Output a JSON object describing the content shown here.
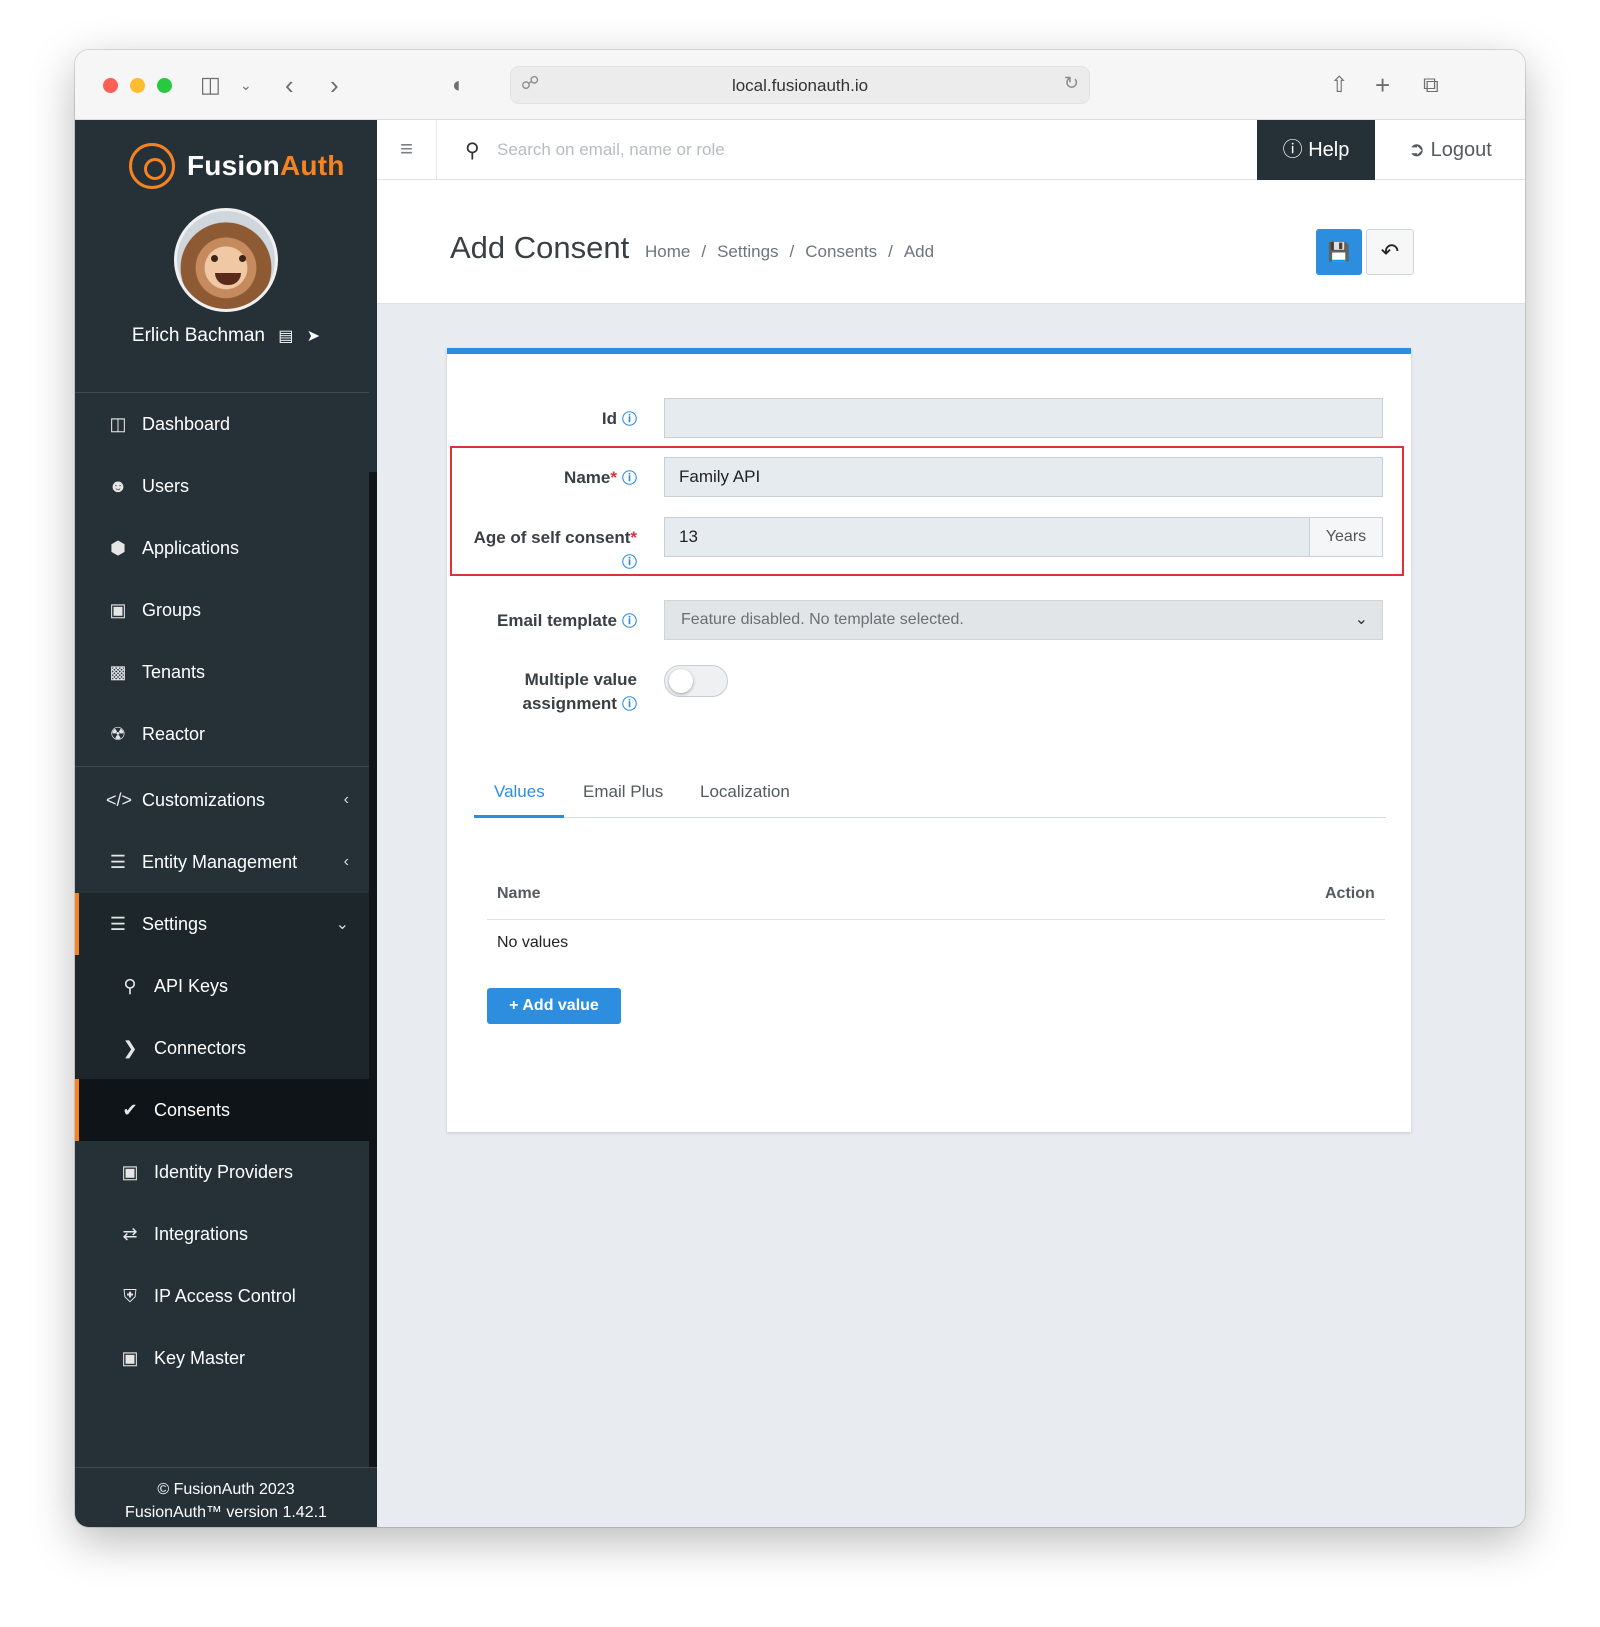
{
  "browser": {
    "url": "local.fusionauth.io"
  },
  "brand": {
    "name_part1": "Fusion",
    "name_part2": "Auth",
    "accent_color": "#f58320",
    "primary_color": "#2d8ee0"
  },
  "user": {
    "name": "Erlich Bachman"
  },
  "sidebar": {
    "items": [
      {
        "label": "Dashboard",
        "icon": "dashboard-icon"
      },
      {
        "label": "Users",
        "icon": "users-icon"
      },
      {
        "label": "Applications",
        "icon": "cube-icon"
      },
      {
        "label": "Groups",
        "icon": "groups-icon"
      },
      {
        "label": "Tenants",
        "icon": "building-icon"
      },
      {
        "label": "Reactor",
        "icon": "reactor-icon"
      },
      {
        "label": "Customizations",
        "icon": "code-icon"
      },
      {
        "label": "Entity Management",
        "icon": "server-icon"
      },
      {
        "label": "Settings",
        "icon": "sliders-icon"
      },
      {
        "label": "API Keys",
        "icon": "key-icon"
      },
      {
        "label": "Connectors",
        "icon": "chevron-right-icon"
      },
      {
        "label": "Consents",
        "icon": "check-icon"
      },
      {
        "label": "Identity Providers",
        "icon": "id-badge-icon"
      },
      {
        "label": "Integrations",
        "icon": "exchange-icon"
      },
      {
        "label": "IP Access Control",
        "icon": "shield-icon"
      },
      {
        "label": "Key Master",
        "icon": "lock-icon"
      }
    ],
    "footer_line1": "© FusionAuth 2023",
    "footer_line2": "FusionAuth™ version 1.42.1"
  },
  "topbar": {
    "search_placeholder": "Search on email, name or role",
    "help_label": "Help",
    "logout_label": "Logout"
  },
  "page": {
    "title": "Add Consent",
    "breadcrumb": [
      "Home",
      "Settings",
      "Consents",
      "Add"
    ]
  },
  "form": {
    "id_label": "Id",
    "id_value": "",
    "name_label": "Name",
    "name_value": "Family API",
    "age_label": "Age of self consent",
    "age_value": "13",
    "age_unit": "Years",
    "email_template_label": "Email template",
    "email_template_value": "Feature disabled. No template selected.",
    "multiple_label_line1": "Multiple value",
    "multiple_label_line2": "assignment",
    "multiple_value": false
  },
  "tabs": [
    "Values",
    "Email Plus",
    "Localization"
  ],
  "values_table": {
    "col_name": "Name",
    "col_action": "Action",
    "empty_text": "No values",
    "add_button": "Add value"
  }
}
